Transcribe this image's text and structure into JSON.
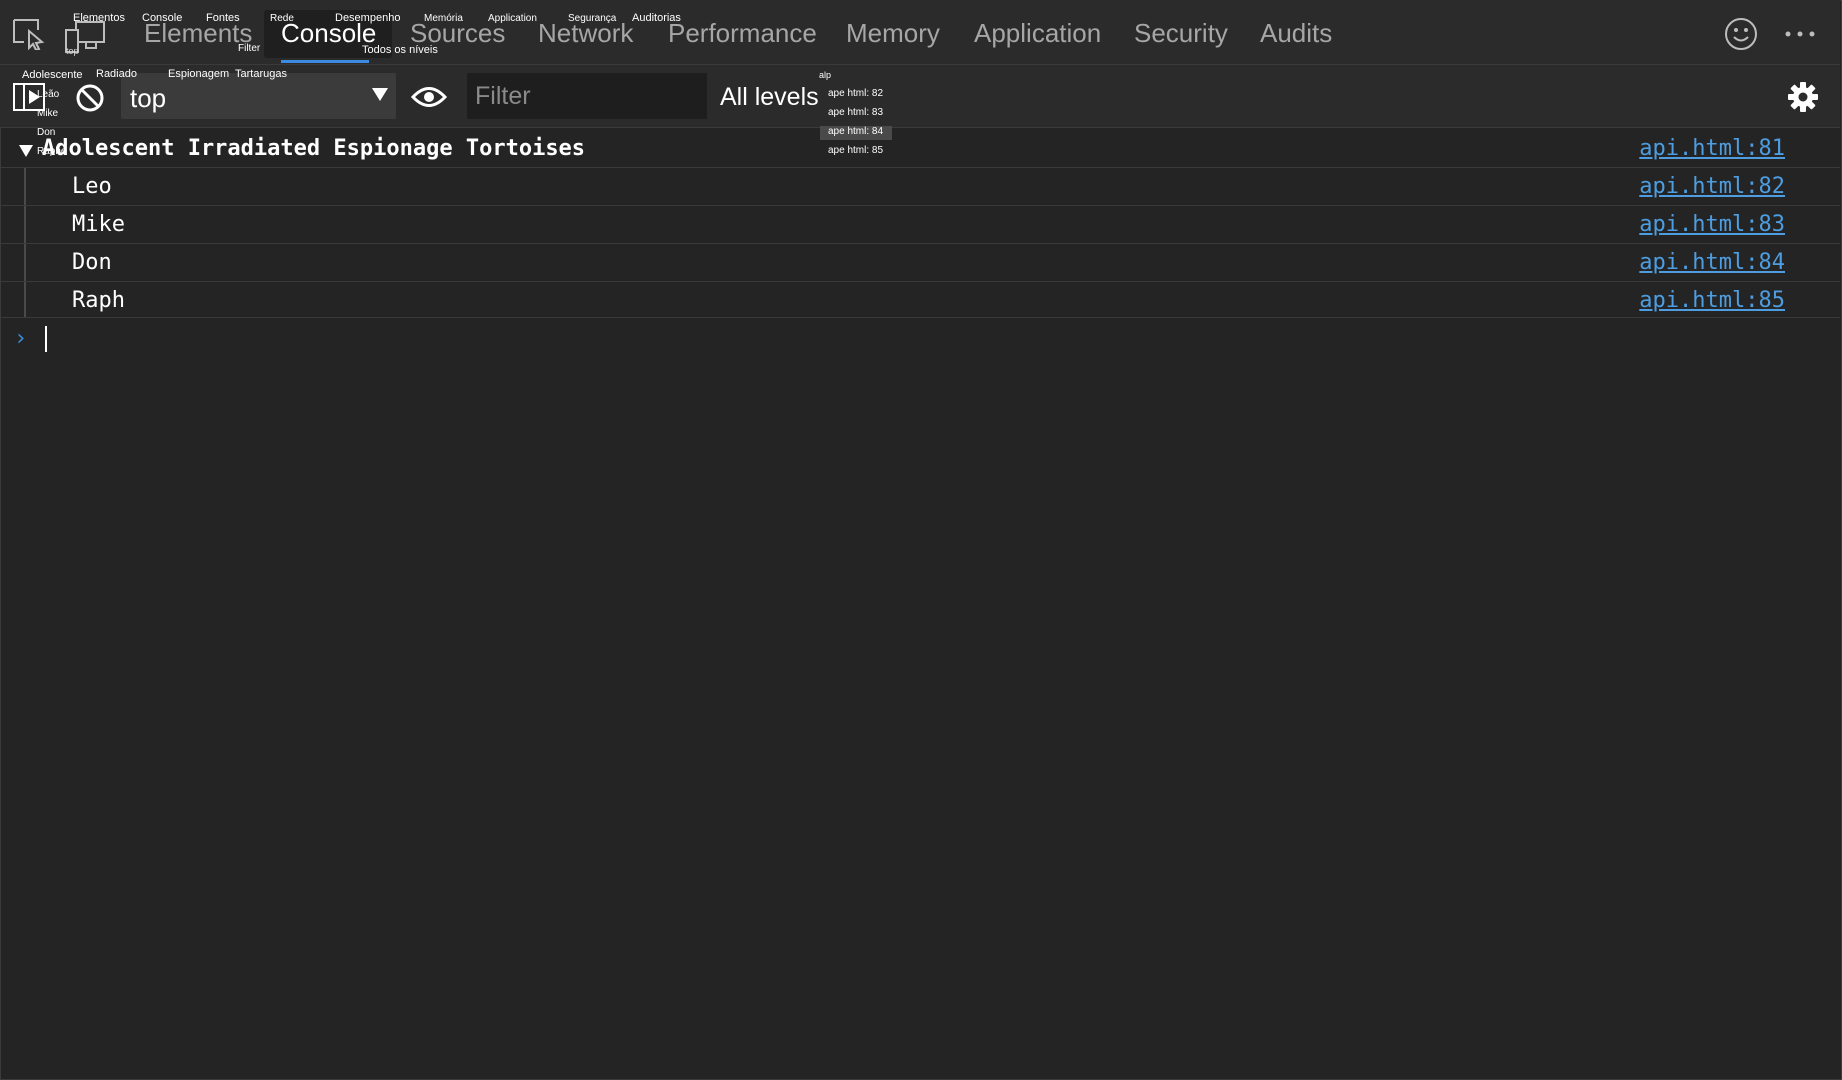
{
  "tabs": [
    {
      "label": "Elements",
      "active": false
    },
    {
      "label": "Console",
      "active": true
    },
    {
      "label": "Sources",
      "active": false
    },
    {
      "label": "Network",
      "active": false
    },
    {
      "label": "Performance",
      "active": false
    },
    {
      "label": "Memory",
      "active": false
    },
    {
      "label": "Application",
      "active": false
    },
    {
      "label": "Security",
      "active": false
    },
    {
      "label": "Audits",
      "active": false
    }
  ],
  "tab_translations": [
    "Elementos",
    "Console",
    "Fontes",
    "Rede",
    "Desempenho",
    "Memória",
    "Application",
    "Segurança",
    "Auditorias"
  ],
  "overlay": {
    "device_label": "top",
    "filter_label": "Filter",
    "all_levels_label": "Todos os níveis",
    "group_words": [
      "Adolescente",
      "Radiado",
      "Espionagem",
      "Tartarugas"
    ],
    "names": [
      "Leão",
      "Mike",
      "Don",
      "Raphe"
    ],
    "link_header": "alp",
    "links": [
      "ape html: 82",
      "ape html: 83",
      "ape html: 84",
      "ape html: 85"
    ]
  },
  "toolbar": {
    "context_value": "top",
    "filter_placeholder": "Filter",
    "levels_label": "All levels"
  },
  "console": {
    "group": {
      "title": "Adolescent Irradiated Espionage Tortoises",
      "source": "api.html:81"
    },
    "items": [
      {
        "text": "Leo",
        "source": "api.html:82"
      },
      {
        "text": "Mike",
        "source": "api.html:83"
      },
      {
        "text": "Don",
        "source": "api.html:84"
      },
      {
        "text": "Raph",
        "source": "api.html:85"
      }
    ]
  },
  "icons": {
    "inspect": "inspect-element-icon",
    "device": "device-toolbar-icon",
    "feedback": "smiley-icon",
    "more": "more-options-icon",
    "sidebar": "show-sidebar-icon",
    "clear": "clear-console-icon",
    "eye": "live-expression-icon",
    "settings": "gear-icon"
  },
  "colors": {
    "accent": "#3d8be0",
    "link": "#4d9de0",
    "background": "#242424",
    "toolbar": "#2b2b2b"
  }
}
